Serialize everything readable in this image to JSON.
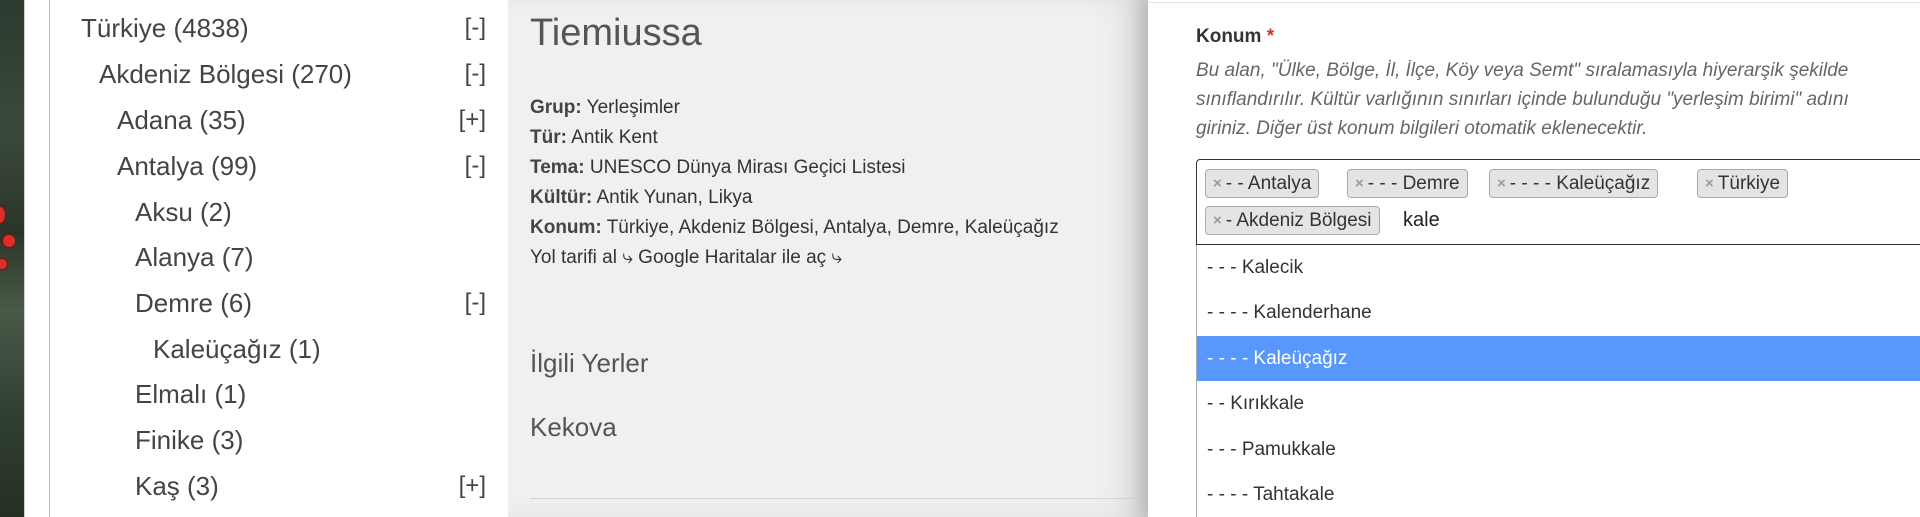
{
  "tree": {
    "items": [
      {
        "label": "Türkiye (4838)",
        "toggle": "[-]"
      },
      {
        "label": "Akdeniz Bölgesi (270)",
        "toggle": "[-]"
      },
      {
        "label": "Adana (35)",
        "toggle": "[+]"
      },
      {
        "label": "Antalya (99)",
        "toggle": "[-]"
      },
      {
        "label": "Aksu (2)",
        "toggle": ""
      },
      {
        "label": "Alanya (7)",
        "toggle": ""
      },
      {
        "label": "Demre (6)",
        "toggle": "[-]"
      },
      {
        "label": "Kaleüçağız (1)",
        "toggle": ""
      },
      {
        "label": "Elmalı (1)",
        "toggle": ""
      },
      {
        "label": "Finike (3)",
        "toggle": ""
      },
      {
        "label": "Kaş (3)",
        "toggle": "[+]"
      }
    ]
  },
  "detail": {
    "title": "Tiemiussa",
    "group_label": "Grup:",
    "group_value": "Yerleşimler",
    "type_label": "Tür:",
    "type_value": "Antik Kent",
    "theme_label": "Tema:",
    "theme_value": "UNESCO Dünya Mirası Geçici Listesi",
    "culture_label": "Kültür:",
    "culture_value": "Antik Yunan, Likya",
    "location_label": "Konum:",
    "location_value": "Türkiye, Akdeniz Bölgesi, Antalya, Demre, Kaleüçağız",
    "directions_link": "Yol tarifi al ⤷",
    "maps_link": "Google Haritalar ile aç ⤷",
    "related_title": "İlgili Yerler",
    "related_items": [
      "Kekova"
    ]
  },
  "form": {
    "field_label": "Konum",
    "required_mark": "*",
    "help_text": "Bu alan, \"Ülke, Bölge, İl, İlçe, Köy veya Semt\" sıralamasıyla hiyerarşik şekilde sınıflandırılır. Kültür varlığının sınırları içinde bulunduğu \"yerleşim birimi\" adını giriniz. Diğer üst konum bilgileri otomatik eklenecektir.",
    "tags": [
      "- - Antalya",
      "- - - Demre",
      "- - - - Kaleüçağız",
      "Türkiye",
      "- Akdeniz Bölgesi"
    ],
    "search_value": "kale",
    "options": [
      "- - - Kalecik",
      "- - - - Kalenderhane",
      "- - - - Kaleüçağız",
      "- - Kırıkkale",
      "- - - Pamukkale",
      "- - - - Tahtakale"
    ],
    "active_option_index": 2,
    "remove_symbol": "×"
  }
}
